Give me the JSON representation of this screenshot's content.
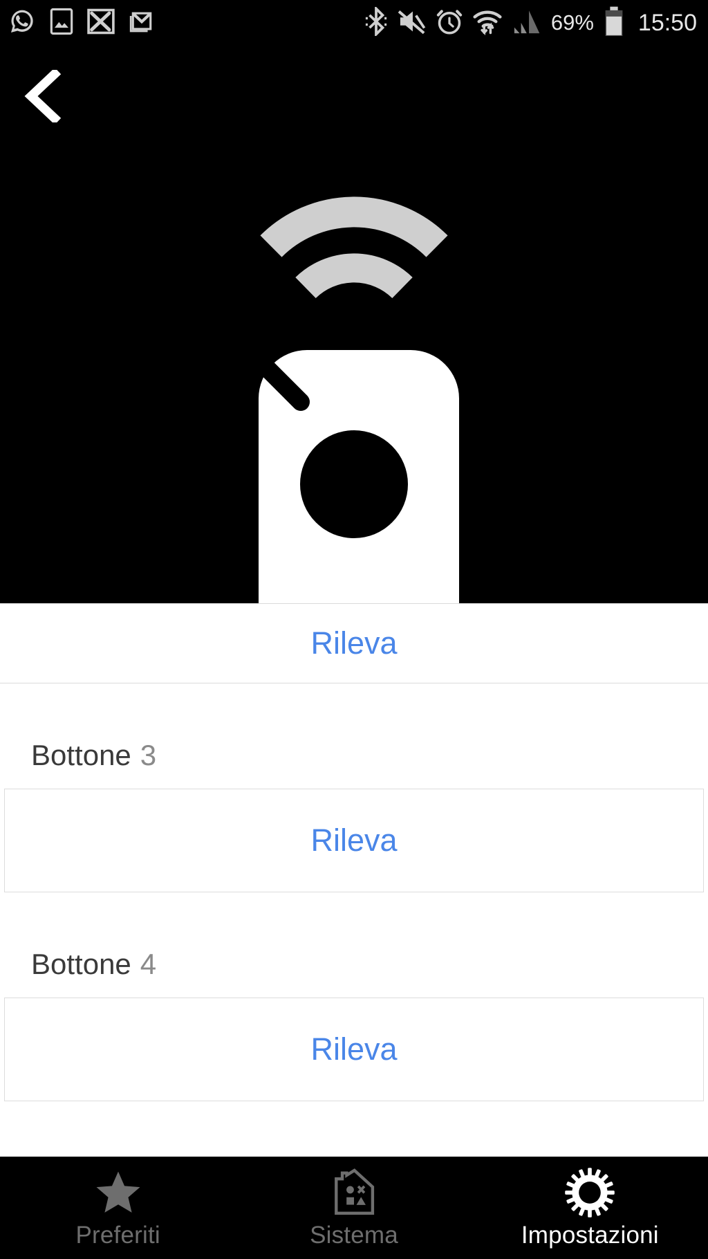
{
  "statusbar": {
    "left_icons": [
      "whatsapp-icon",
      "gallery-icon",
      "x-mail-icon",
      "gmail-icon"
    ],
    "right_icons": [
      "bluetooth-icon",
      "mute-icon",
      "alarm-icon",
      "wifi-icon",
      "signal-icon"
    ],
    "battery_percent": "69%",
    "time": "15:50"
  },
  "header": {
    "back_icon": "back-chevron-icon"
  },
  "hero": {
    "icon_name": "wireless-remote-icon",
    "background_color": "#000000",
    "icon_color": "#ffffff",
    "wave_color": "#cfcfcf"
  },
  "colors": {
    "accent_blue": "#4a86e8",
    "label_dark": "#3a3a3a",
    "label_muted": "#8a8a8a",
    "divider": "#dcdcdc",
    "nav_inactive": "#6e6e6e",
    "nav_active": "#ffffff"
  },
  "list": {
    "top_action": {
      "label": "Rileva"
    },
    "sections": [
      {
        "title": "Bottone",
        "number": "3",
        "action_label": "Rileva"
      },
      {
        "title": "Bottone",
        "number": "4",
        "action_label": "Rileva"
      }
    ]
  },
  "bottomnav": {
    "items": [
      {
        "label": "Preferiti",
        "icon": "star-icon",
        "active": false
      },
      {
        "label": "Sistema",
        "icon": "house-icon",
        "active": false
      },
      {
        "label": "Impostazioni",
        "icon": "gear-icon",
        "active": true
      }
    ]
  }
}
